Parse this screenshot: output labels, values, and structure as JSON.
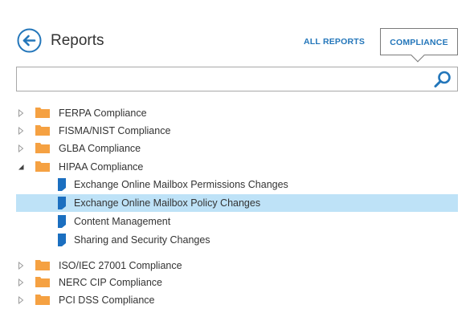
{
  "header": {
    "title": "Reports",
    "tabs": [
      {
        "label": "ALL REPORTS",
        "active": false
      },
      {
        "label": "COMPLIANCE",
        "active": true
      }
    ]
  },
  "search": {
    "value": "",
    "placeholder": ""
  },
  "tree": {
    "folders": [
      {
        "label": "FERPA Compliance",
        "expanded": false
      },
      {
        "label": "FISMA/NIST Compliance",
        "expanded": false
      },
      {
        "label": "GLBA Compliance",
        "expanded": false
      },
      {
        "label": "HIPAA Compliance",
        "expanded": true
      },
      {
        "label": "ISO/IEC 27001 Compliance",
        "expanded": false
      },
      {
        "label": "NERC CIP Compliance",
        "expanded": false
      },
      {
        "label": "PCI DSS Compliance",
        "expanded": false
      }
    ],
    "hipaa_reports": [
      {
        "label": "Exchange Online Mailbox Permissions Changes",
        "selected": false
      },
      {
        "label": "Exchange Online Mailbox Policy Changes",
        "selected": true
      },
      {
        "label": "Content Management",
        "selected": false
      },
      {
        "label": "Sharing and Security Changes",
        "selected": false
      }
    ]
  },
  "colors": {
    "accent": "#2376ba",
    "folder": "#f5a142",
    "report_icon": "#1b6fc0",
    "selection": "#bee2f7",
    "expander": "#9a9a9a"
  },
  "icons": {
    "back": "arrow-left-circle-icon",
    "search": "magnifier-icon",
    "folder": "folder-icon",
    "report": "report-document-icon",
    "collapsed": "triangle-right-outline-icon",
    "expanded": "triangle-down-filled-icon"
  }
}
